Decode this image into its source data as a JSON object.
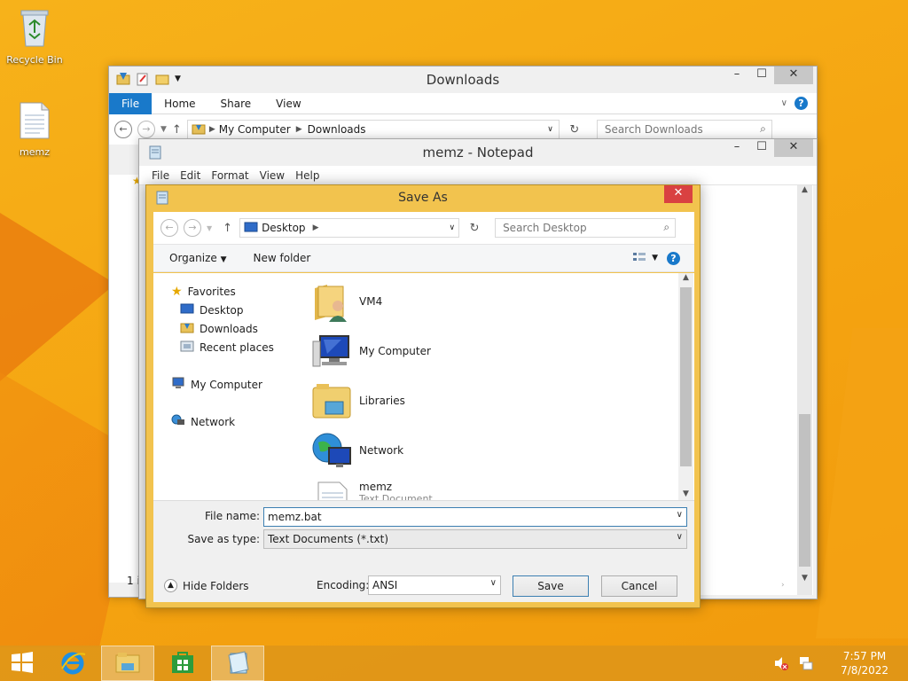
{
  "desktop": {
    "icons": [
      {
        "label": "Recycle Bin",
        "icon": "recycle-bin-icon"
      },
      {
        "label": "memz",
        "icon": "text-file-icon"
      }
    ]
  },
  "explorer": {
    "title": "Downloads",
    "ribbon_tabs": [
      "File",
      "Home",
      "Share",
      "View"
    ],
    "breadcrumb": [
      "My Computer",
      "Downloads"
    ],
    "search_placeholder": "Search Downloads",
    "status_fragment": "1 i"
  },
  "notepad": {
    "title": "memz - Notepad",
    "menu": [
      "File",
      "Edit",
      "Format",
      "View",
      "Help"
    ]
  },
  "save_as": {
    "title": "Save As",
    "location": "Desktop",
    "search_placeholder": "Search Desktop",
    "toolbar": {
      "organize": "Organize",
      "new_folder": "New folder"
    },
    "nav_tree": {
      "favorites_label": "Favorites",
      "favorites": [
        "Desktop",
        "Downloads",
        "Recent places"
      ],
      "my_computer": "My Computer",
      "network": "Network"
    },
    "files": [
      {
        "name": "VM4",
        "icon": "user-folder-icon"
      },
      {
        "name": "My Computer",
        "icon": "computer-icon"
      },
      {
        "name": "Libraries",
        "icon": "libraries-icon"
      },
      {
        "name": "Network",
        "icon": "network-icon"
      },
      {
        "name": "memz",
        "subtitle": "Text Document",
        "icon": "text-file-icon"
      }
    ],
    "file_name_label": "File name:",
    "file_name_value": "memz.bat",
    "save_type_label": "Save as type:",
    "save_type_value": "Text Documents (*.txt)",
    "hide_folders": "Hide Folders",
    "encoding_label": "Encoding:",
    "encoding_value": "ANSI",
    "save_button": "Save",
    "cancel_button": "Cancel"
  },
  "taskbar": {
    "time": "7:57 PM",
    "date": "7/8/2022"
  },
  "colors": {
    "desktop": "#f5a612",
    "accent": "#1979ca",
    "dialog_frame": "#f2c34e",
    "close_red": "#d94141"
  }
}
